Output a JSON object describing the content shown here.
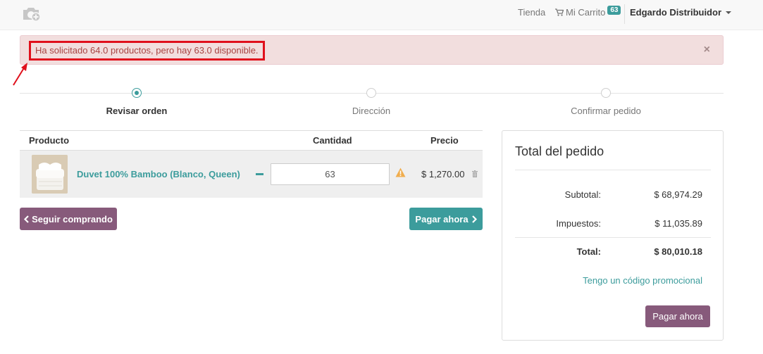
{
  "navbar": {
    "logo_icon": "camera-plus-icon",
    "shop": "Tienda",
    "cart_label": "Mi Carrito",
    "cart_count": "63",
    "user": "Edgardo Distribuidor"
  },
  "alert": {
    "message": "Ha solicitado 64.0 productos, pero hay 63.0 disponible.",
    "close": "×"
  },
  "wizard": {
    "steps": [
      {
        "label": "Revisar orden",
        "active": true
      },
      {
        "label": "Dirección",
        "active": false
      },
      {
        "label": "Confirmar pedido",
        "active": false
      }
    ]
  },
  "cart_table": {
    "headers": {
      "product": "Producto",
      "quantity": "Cantidad",
      "price": "Precio"
    },
    "rows": [
      {
        "product": "Duvet 100% Bamboo (Blanco, Queen)",
        "quantity": "63",
        "price": "$ 1,270.00"
      }
    ]
  },
  "actions": {
    "continue": "Seguir comprando",
    "pay": "Pagar ahora"
  },
  "summary": {
    "title": "Total del pedido",
    "subtotal_label": "Subtotal:",
    "subtotal": "$ 68,974.29",
    "taxes_label": "Impuestos:",
    "taxes": "$ 11,035.89",
    "total_label": "Total:",
    "total": "$ 80,010.18",
    "promo": "Tengo un código promocional",
    "pay": "Pagar ahora"
  },
  "colors": {
    "primary": "#875a7b",
    "teal": "#3c9c9c",
    "alert_bg": "#f2dede",
    "alert_text": "#a94442",
    "annotation": "#e0101c",
    "warning": "#f0ad4e"
  }
}
